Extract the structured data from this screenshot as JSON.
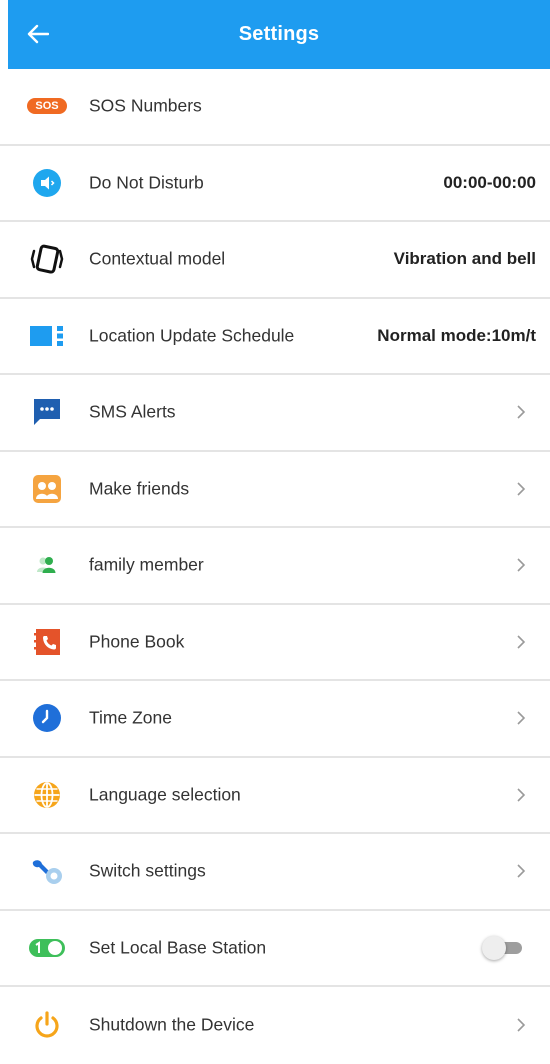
{
  "header": {
    "title": "Settings",
    "back_icon": "arrow-left-icon"
  },
  "colors": {
    "header_bg": "#1e9cf0",
    "sos": "#f06a22",
    "blue": "#1e9cf0",
    "dark_blue": "#1f5fb0",
    "orange": "#f5a440",
    "green": "#3ebf5a",
    "red_orange": "#e4532a",
    "yellow_orange": "#f6a51a"
  },
  "settings": {
    "items": [
      {
        "name": "sos-numbers",
        "icon": "sos-icon",
        "label": "SOS Numbers",
        "sos_text": "SOS"
      },
      {
        "name": "do-not-disturb",
        "icon": "mute-speaker-icon",
        "label": "Do Not Disturb",
        "value": "00:00-00:00"
      },
      {
        "name": "contextual-model",
        "icon": "vibrate-phone-icon",
        "label": "Contextual model",
        "value": "Vibration and bell"
      },
      {
        "name": "location-update-schedule",
        "icon": "location-schedule-icon",
        "label": "Location Update Schedule",
        "value": "Normal mode:10m/t"
      },
      {
        "name": "sms-alerts",
        "icon": "chat-bubble-icon",
        "label": "SMS Alerts"
      },
      {
        "name": "make-friends",
        "icon": "friends-icon",
        "label": "Make friends"
      },
      {
        "name": "family-member",
        "icon": "family-icon",
        "label": "family member"
      },
      {
        "name": "phone-book",
        "icon": "phone-book-icon",
        "label": "Phone Book"
      },
      {
        "name": "time-zone",
        "icon": "clock-icon",
        "label": "Time Zone"
      },
      {
        "name": "language-selection",
        "icon": "globe-icon",
        "label": "Language selection"
      },
      {
        "name": "switch-settings",
        "icon": "wrench-icon",
        "label": "Switch settings"
      },
      {
        "name": "set-local-base-station",
        "icon": "toggle-on-icon",
        "label": "Set Local Base Station",
        "toggle_on": false
      },
      {
        "name": "shutdown-device",
        "icon": "power-icon",
        "label": "Shutdown the Device"
      }
    ]
  }
}
